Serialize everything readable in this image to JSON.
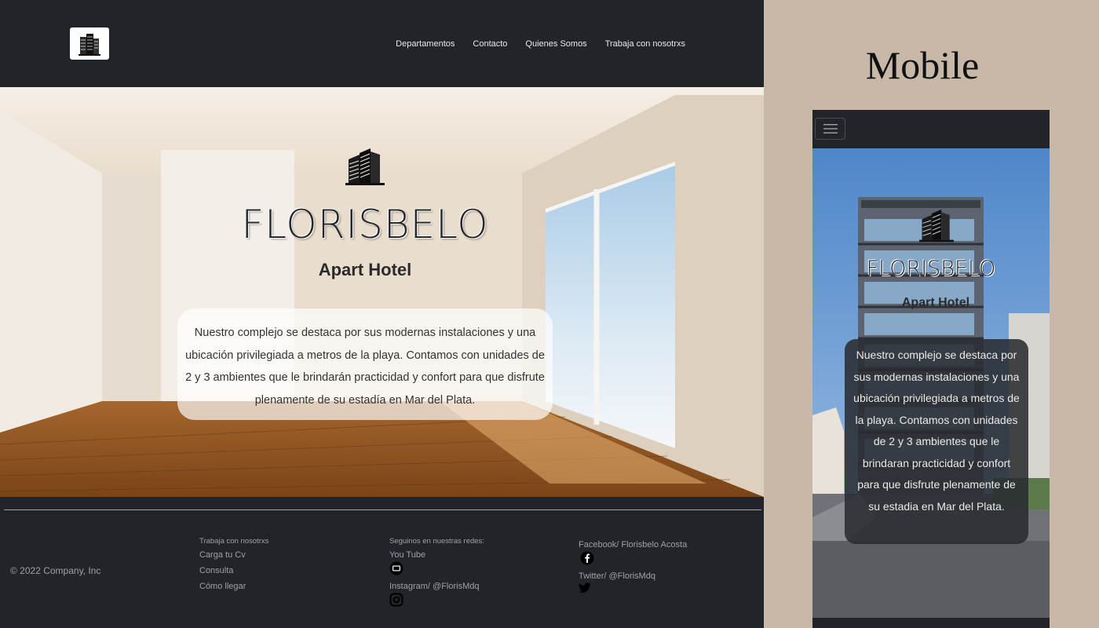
{
  "desktop": {
    "nav": {
      "logo_icon": "building-logo-icon",
      "items": [
        "Departamentos",
        "Contacto",
        "Quienes Somos",
        "Trabaja con nosotrxs"
      ]
    },
    "hero": {
      "icon": "building-icon",
      "title": "FLORISBELO",
      "subtitle": "Apart Hotel",
      "description": "Nuestro complejo se destaca por sus modernas instalaciones y una ubicación privilegiada a metros de la playa. Contamos con unidades de 2 y 3 ambientes que le brindarán practicidad y confort para que disfrute plenamente de su estadía en Mar del Plata."
    },
    "footer": {
      "copyright": "© 2022 Company, Inc",
      "col1": {
        "heading": "Trabaja con nosotrxs",
        "links": [
          "Carga tu Cv",
          "Consulta",
          "Cómo llegar"
        ]
      },
      "col2": {
        "heading": "Seguinos en nuestras redes:",
        "youtube": "You Tube",
        "instagram": "Instagram/ @FlorisMdq"
      },
      "col3": {
        "facebook": "Facebook/ Florisbelo Acosta",
        "twitter": "Twitter/ @FlorisMdq"
      }
    }
  },
  "mobile": {
    "label": "Mobile",
    "toggler_icon": "hamburger-menu-icon",
    "hero": {
      "title": "FLORISBELO",
      "subtitle": "Apart Hotel",
      "description": "Nuestro complejo se destaca por sus modernas instalaciones y una ubicación privilegiada a metros de la playa. Contamos con unidades de 2 y 3 ambientes que le brindaran practicidad y confort para que disfrute plenamente de su estadia en Mar del Plata."
    }
  },
  "colors": {
    "dark": "#212529",
    "page_bg": "#c7b8a8",
    "footer_text": "#9ea1a6"
  }
}
